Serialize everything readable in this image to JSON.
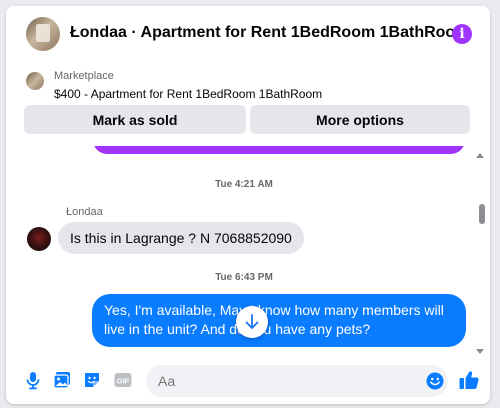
{
  "header": {
    "title": "Łondaa · Apartment for Rent 1BedRoom 1BathRoom",
    "info_icon": "info-icon",
    "info_glyph": "i"
  },
  "marketplace": {
    "label": "Marketplace",
    "listing": "$400 - Apartment for Rent 1BedRoom 1BathRoom",
    "mark_sold": "Mark as sold",
    "more_options": "More options"
  },
  "chat": {
    "time1": "Tue 4:21 AM",
    "sender": "Łondaa",
    "incoming": "Is this in Lagrange ? N 7068852090",
    "time2": "Tue 6:43 PM",
    "outgoing": "Yes, I'm available, May I know how many members will live in the unit? And do you have any pets?"
  },
  "composer": {
    "placeholder": "Aa",
    "icons": [
      "microphone-icon",
      "photo-icon",
      "sticker-icon",
      "gif-icon",
      "emoji-icon",
      "thumbs-up-icon"
    ]
  },
  "colors": {
    "accent": "#0a7cff",
    "info": "#a033ff",
    "incoming_bubble": "#e4e6eb"
  }
}
